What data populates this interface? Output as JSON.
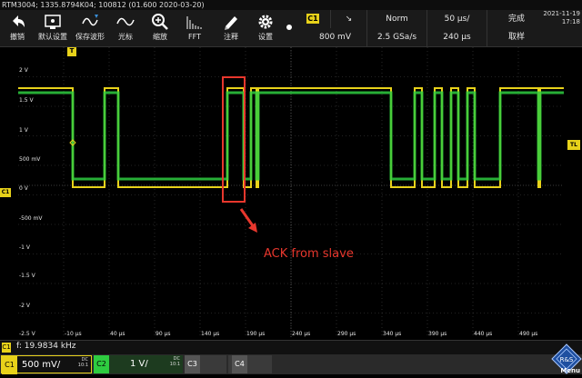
{
  "title": "RTM3004; 1335.8794K04; 100812 (01.600 2020-03-20)",
  "toolbar": {
    "undo": "撤销",
    "default_setup": "默认设置",
    "save_waveform": "保存波形",
    "cursor": "光标",
    "zoom": "缩放",
    "fft": "FFT",
    "annotate": "注释",
    "settings": "设置"
  },
  "hud": {
    "channel": "C1",
    "trigger_slope": "↘",
    "mode": "Norm",
    "time_div": "50 µs/",
    "status": "完成",
    "trigger_level": "800 mV",
    "sample_rate": "2.5 GSa/s",
    "record_length": "240 µs",
    "acquire": "取样",
    "date": "2021-11-19",
    "time": "17:18"
  },
  "grid": {
    "y_labels": [
      "2 V",
      "1.5 V",
      "1 V",
      "500 mV",
      "0 V",
      "-500 mV",
      "-1 V",
      "-1.5 V",
      "-2 V",
      "-2.5 V"
    ],
    "x_labels": [
      "-10 µs",
      "40 µs",
      "90 µs",
      "140 µs",
      "190 µs",
      "240 µs",
      "290 µs",
      "340 µs",
      "390 µs",
      "440 µs",
      "490 µs"
    ],
    "trigger_marker": "T",
    "left_marker": "C1",
    "right_marker": "TL"
  },
  "annotation": "ACK from slave",
  "measurement": {
    "channel": "C1",
    "text": "f: 19.9834 kHz"
  },
  "channels": [
    {
      "name": "C1",
      "value": "500 mV/",
      "coupling": "DC",
      "probe": "10:1",
      "color": "#e8d21a"
    },
    {
      "name": "C2",
      "value": "1 V/",
      "coupling": "DC",
      "probe": "10:1",
      "color": "#2ecc40"
    },
    {
      "name": "C3",
      "value": "",
      "coupling": "",
      "probe": "",
      "color": "#555555"
    },
    {
      "name": "C4",
      "value": "",
      "coupling": "",
      "probe": "",
      "color": "#555555"
    }
  ],
  "menu_label": "Menu",
  "colors": {
    "ch1": "#e8d21a",
    "ch2": "#2ecc40",
    "annotation": "#e8372d",
    "grid": "#555555"
  }
}
